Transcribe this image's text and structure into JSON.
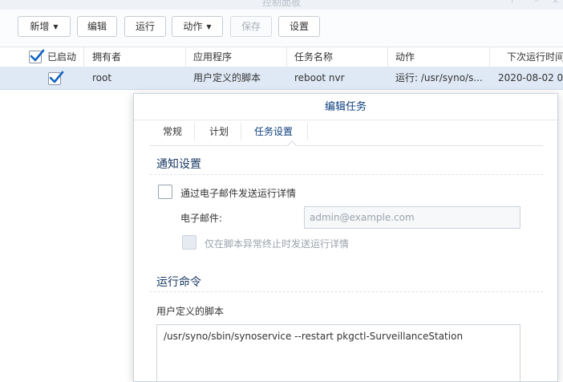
{
  "window": {
    "title": "控制面板",
    "help_icon": "?",
    "minimize_icon": "–",
    "close_icon": "×"
  },
  "toolbar": {
    "create_label": "新增",
    "edit_label": "编辑",
    "run_label": "运行",
    "action_label": "动作",
    "save_label": "保存",
    "settings_label": "设置"
  },
  "grid": {
    "columns": [
      "已启动",
      "拥有者",
      "应用程序",
      "任务名称",
      "动作",
      "下次运行时间"
    ],
    "rows": [
      {
        "enabled": true,
        "owner": "root",
        "application": "用户定义的脚本",
        "task_name": "reboot nvr",
        "action": "运行: /usr/syno/s...",
        "next_run": "2020-08-02 0"
      }
    ]
  },
  "dialog": {
    "title": "编辑任务",
    "tabs": [
      "常规",
      "计划",
      "任务设置"
    ],
    "active_tab": "任务设置",
    "notification": {
      "section_title": "通知设置",
      "send_email_label": "通过电子邮件发送运行详情",
      "send_email_checked": false,
      "email_label": "电子邮件:",
      "email_placeholder": "admin@example.com",
      "only_abnormal_label": "仅在脚本异常终止时发送运行详情",
      "only_abnormal_checked": false
    },
    "run_command": {
      "section_title": "运行命令",
      "script_label": "用户定义的脚本",
      "script": "/usr/syno/sbin/synoservice --restart pkgctl-SurveillanceStation"
    }
  },
  "colors": {
    "accent": "#0c3f7d",
    "selected_row": "#dfe9f5",
    "check_blue": "#1565c0"
  }
}
